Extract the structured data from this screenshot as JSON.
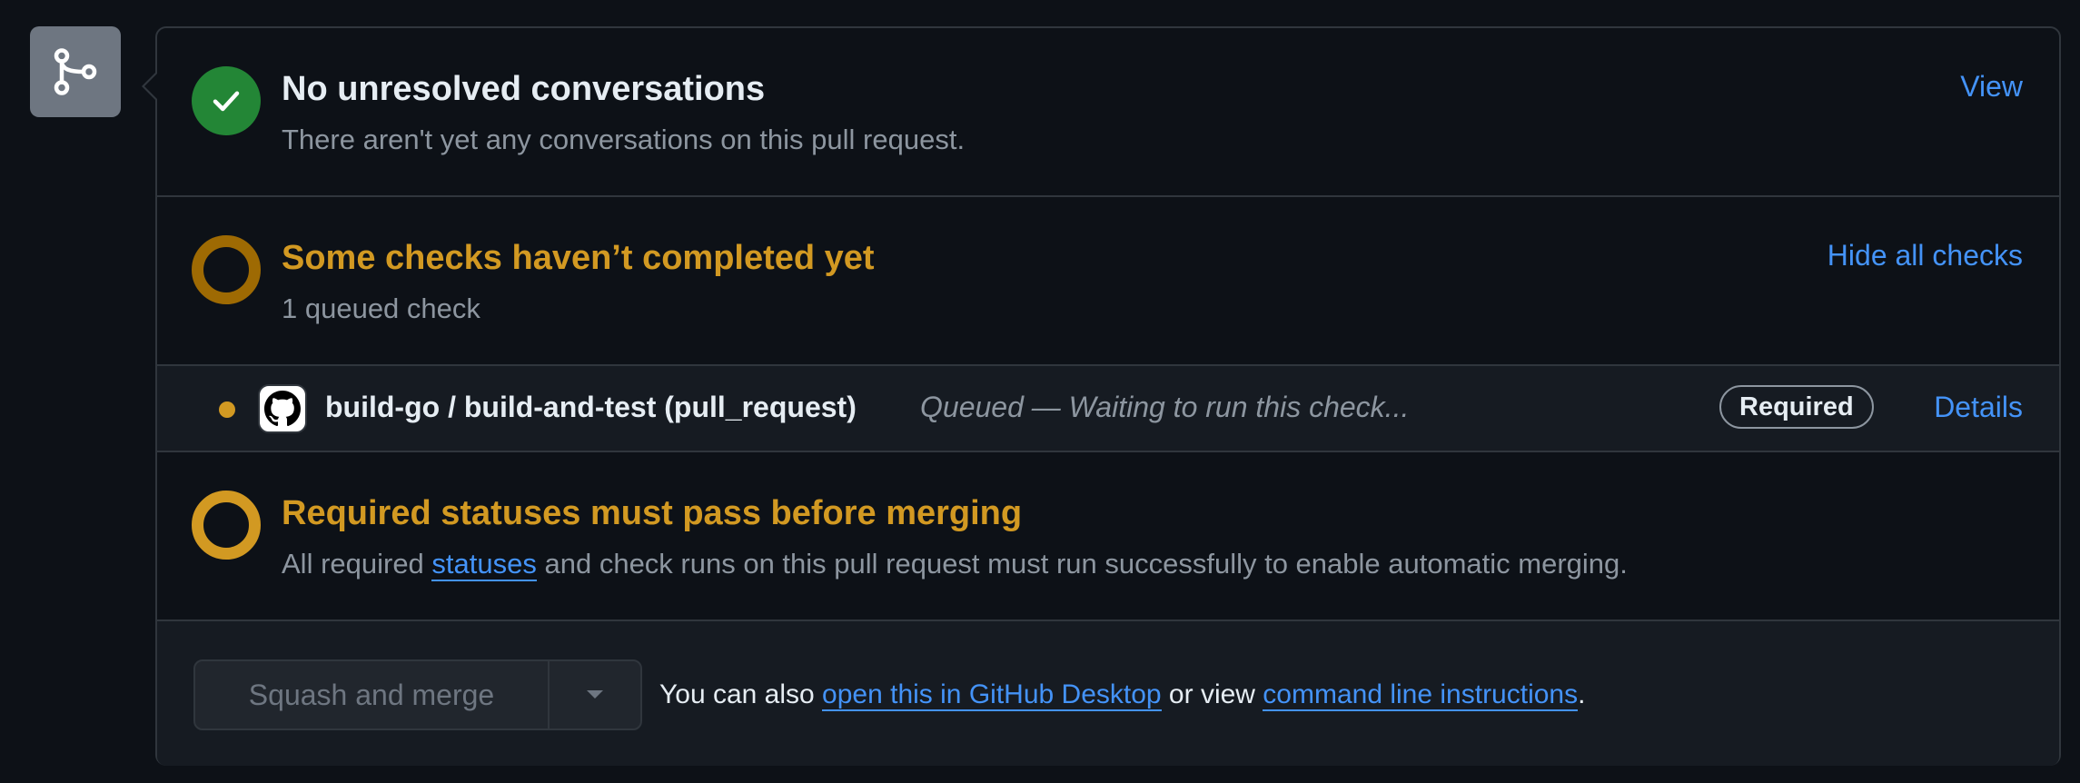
{
  "conversations": {
    "title": "No unresolved conversations",
    "subtitle": "There aren't yet any conversations on this pull request.",
    "view_link": "View"
  },
  "checks": {
    "title": "Some checks haven’t completed yet",
    "subtitle": "1 queued check",
    "toggle_link": "Hide all checks",
    "items": [
      {
        "name": "build-go / build-and-test (pull_request)",
        "status": "Queued — Waiting to run this check...",
        "badge": "Required",
        "details_link": "Details"
      }
    ]
  },
  "required_statuses": {
    "title": "Required statuses must pass before merging",
    "subtitle_prefix": "All required ",
    "subtitle_link": "statuses",
    "subtitle_suffix": " and check runs on this pull request must run successfully to enable automatic merging."
  },
  "merge": {
    "button_label": "Squash and merge",
    "note_prefix": "You can also ",
    "desktop_link": "open this in GitHub Desktop",
    "note_middle": " or view ",
    "cli_link": "command line instructions",
    "note_suffix": "."
  },
  "colors": {
    "success": "#238636",
    "pending": "#d29922",
    "link": "#4493f8",
    "background": "#0d1117",
    "border": "#30363d"
  },
  "icons": {
    "merge_box": "git-merge-icon",
    "success": "check-icon",
    "pending": "pending-circle-icon",
    "avatar": "github-logo-icon",
    "dropdown": "triangle-down-icon"
  }
}
